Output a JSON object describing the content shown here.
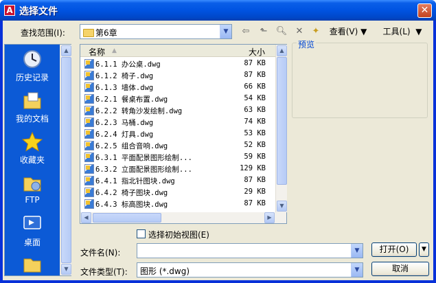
{
  "window": {
    "title": "选择文件",
    "close_glyph": "✕",
    "app_icon_letter": "A"
  },
  "lookin": {
    "label": "查找范围(I):",
    "value": "第6章"
  },
  "toolbar": {
    "view_label": "查看(V)",
    "tools_label": "工具(L)"
  },
  "places": [
    {
      "label": "历史记录",
      "icon": "history-icon"
    },
    {
      "label": "我的文档",
      "icon": "documents-icon"
    },
    {
      "label": "收藏夹",
      "icon": "favorites-icon"
    },
    {
      "label": "FTP",
      "icon": "ftp-icon"
    },
    {
      "label": "桌面",
      "icon": "desktop-icon"
    }
  ],
  "files": {
    "col_name": "名称",
    "col_size": "大小",
    "rows": [
      {
        "name": "6.1.1  办公桌.dwg",
        "size": "87 KB"
      },
      {
        "name": "6.1.2  椅子.dwg",
        "size": "87 KB"
      },
      {
        "name": "6.1.3  墙体.dwg",
        "size": "66 KB"
      },
      {
        "name": "6.2.1  餐桌布置.dwg",
        "size": "54 KB"
      },
      {
        "name": "6.2.2  转角沙发绘制.dwg",
        "size": "63 KB"
      },
      {
        "name": "6.2.3  马桶.dwg",
        "size": "74 KB"
      },
      {
        "name": "6.2.4  灯具.dwg",
        "size": "53 KB"
      },
      {
        "name": "6.2.5  组合音响.dwg",
        "size": "52 KB"
      },
      {
        "name": "6.3.1  平面配景图形绘制...",
        "size": "59 KB"
      },
      {
        "name": "6.3.2  立面配景图形绘制...",
        "size": "129 KB"
      },
      {
        "name": "6.4.1  指北针图块.dwg",
        "size": "87 KB"
      },
      {
        "name": "6.4.2  椅子图块.dwg",
        "size": "29 KB"
      },
      {
        "name": "6.4.3  标高图块.dwg",
        "size": "87 KB"
      }
    ]
  },
  "preview": {
    "label": "预览"
  },
  "initial_view": {
    "label": "选择初始视图(E)",
    "checked": false
  },
  "filename": {
    "label": "文件名(N):",
    "value": ""
  },
  "filetype": {
    "label": "文件类型(T):",
    "value": "图形 (*.dwg)"
  },
  "buttons": {
    "open": "打开(O)",
    "cancel": "取消"
  }
}
